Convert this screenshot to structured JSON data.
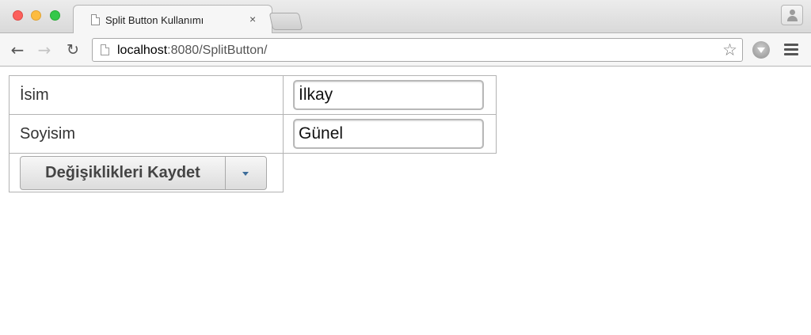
{
  "browser": {
    "tab": {
      "title": "Split Button Kullanımı",
      "close_glyph": "×"
    },
    "url": {
      "host": "localhost",
      "rest": ":8080/SplitButton/"
    },
    "icons": {
      "back": "arrow-left-icon",
      "forward": "arrow-right-icon",
      "reload": "reload-icon",
      "bookmark": "star-icon",
      "extension": "download-icon",
      "menu": "hamburger-menu-icon",
      "profile": "user-icon"
    }
  },
  "form": {
    "first_name": {
      "label": "İsim",
      "value": "İlkay"
    },
    "last_name": {
      "label": "Soyisim",
      "value": "Günel"
    },
    "save_button": {
      "label": "Değişiklikleri Kaydet"
    }
  }
}
